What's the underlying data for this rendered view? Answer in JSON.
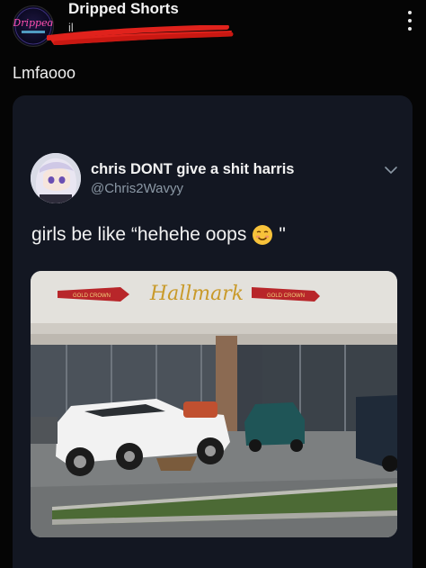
{
  "post": {
    "channel_name": "Dripped Shorts",
    "subtitle_visible": "il",
    "caption": "Lmfaooo",
    "avatar_logo_text": "Dripped"
  },
  "tweet": {
    "display_name": "chris DONT give a shit harris",
    "handle": "@Chris2Wavyy",
    "text": "girls be like “hehehe oops",
    "text_tail": "\"",
    "emoji": "smiling-face-icon"
  },
  "photo": {
    "store_sign": "Hallmark",
    "crown_text": "GOLD CROWN",
    "description_colors": {
      "sky": "#9aa6b2",
      "store": "#e5e3de",
      "brick": "#8b6a52"
    }
  },
  "colors": {
    "background": "#050505",
    "card": "#131722",
    "redaction": "#e0221c",
    "handle": "#8b98a5"
  }
}
